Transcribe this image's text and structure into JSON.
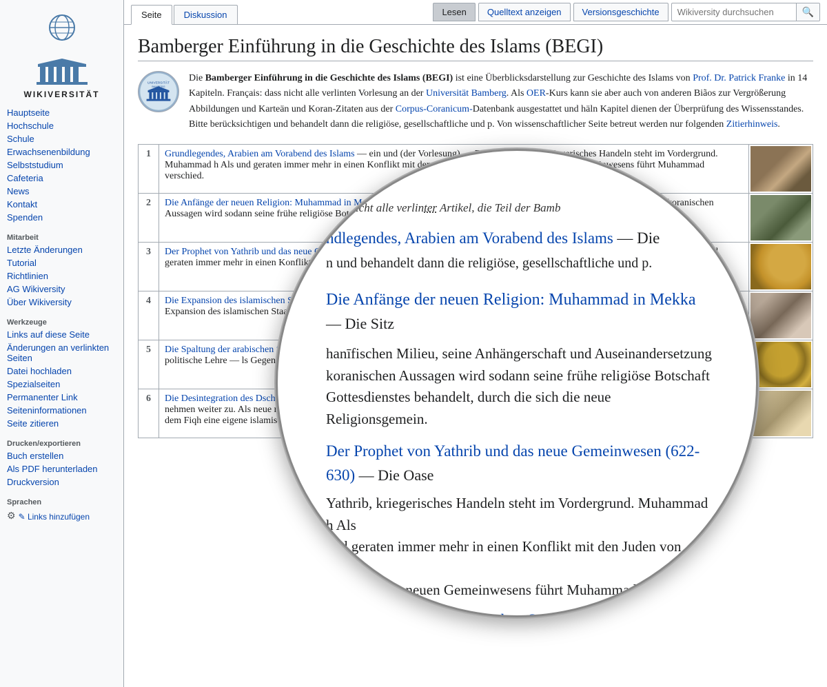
{
  "logo": {
    "text": "WIKIVERSITÄT"
  },
  "sidebar": {
    "nav_main": [
      {
        "label": "Hauptseite",
        "href": "#"
      },
      {
        "label": "Hochschule",
        "href": "#"
      },
      {
        "label": "Schule",
        "href": "#"
      },
      {
        "label": "Erwachsenenbildung",
        "href": "#"
      },
      {
        "label": "Selbststudium",
        "href": "#"
      },
      {
        "label": "Cafeteria",
        "href": "#"
      },
      {
        "label": "News",
        "href": "#"
      },
      {
        "label": "Kontakt",
        "href": "#"
      },
      {
        "label": "Spenden",
        "href": "#"
      }
    ],
    "section_mitarbeit": "Mitarbeit",
    "nav_mitarbeit": [
      {
        "label": "Letzte Änderungen",
        "href": "#"
      },
      {
        "label": "Tutorial",
        "href": "#"
      },
      {
        "label": "Richtlinien",
        "href": "#"
      },
      {
        "label": "AG Wikiversity",
        "href": "#"
      },
      {
        "label": "Über Wikiversity",
        "href": "#"
      }
    ],
    "section_werkzeuge": "Werkzeuge",
    "nav_werkzeuge": [
      {
        "label": "Links auf diese Seite",
        "href": "#"
      },
      {
        "label": "Änderungen an verlinkten Seiten",
        "href": "#"
      },
      {
        "label": "Datei hochladen",
        "href": "#"
      },
      {
        "label": "Spezialseiten",
        "href": "#"
      },
      {
        "label": "Permanenter Link",
        "href": "#"
      },
      {
        "label": "Seiteninformationen",
        "href": "#"
      },
      {
        "label": "Seite zitieren",
        "href": "#"
      }
    ],
    "section_drucken": "Drucken/exportieren",
    "nav_drucken": [
      {
        "label": "Buch erstellen",
        "href": "#"
      },
      {
        "label": "Als PDF herunterladen",
        "href": "#"
      },
      {
        "label": "Druckversion",
        "href": "#"
      }
    ],
    "section_sprachen": "Sprachen",
    "lang_add": "✎ Links hinzufügen"
  },
  "tabs": {
    "left": [
      {
        "label": "Seite",
        "active": true
      },
      {
        "label": "Diskussion",
        "active": false
      }
    ],
    "right": [
      {
        "label": "Lesen",
        "active": true
      },
      {
        "label": "Quelltext anzeigen",
        "active": false
      },
      {
        "label": "Versionsgeschichte",
        "active": false
      }
    ],
    "search_placeholder": "Wikiversity durchsuchen"
  },
  "page": {
    "title": "Bamberger Einführung in die Geschichte des Islams (BEGI)",
    "intro": "Die Bamberger Einführung in die Geschichte des Islams (BEGI) ist eine Überblicksdarstellung zur Geschichte des Islams von Prof. Dr. Patrick Franke in 14 Kapiteln. Français: dass nicht alle verlinten Vorlesung an der Universität Bamberg. Als OER-Kurs kann sie aber auch von anderen Biãos zur Vergrößerung Abbildungen und Karteän und Koran-Zitaten aus der Corpus-Coranicum-Datenbank ausgestattet und häln Kapitel dienen der Überprüfung des Wissensstandes.",
    "note": "Bitte berücksichtigen und behandelt dann die religiöse, gesellschaftliche und p. Von wissenschaftlicher Seite betreut werden nur folgenden Zitierhinweis.",
    "zitierhinweis_label": "Zitierhinweis",
    "table_rows": [
      {
        "num": "1",
        "title": "Grundlegendes, Arabien am Vorabend des Islams",
        "desc": "ein und (der Vorlesung) — Die Oase Yathrib, kriegerisches Handeln steht im Vordergrund. Muhammad h Als und geraten immer mehr in einen Konflikt mit den Juden von Yath. Anführer des neuen Gemeinwesens führt Muhammad verschied.",
        "img_class": "img-1"
      },
      {
        "num": "2",
        "title": "Die Anfänge der neuen Religion: Muhammad in Mekka",
        "desc": "hanīfischen Milieu, seine Anhängerschaft und Auseinandersetzung im koranischen Aussagen wird sodann seine frühe religiöse Botschaft von Gottesdienstes behandelt, durch die sich die neue Religionsgemein.",
        "img_class": "img-2"
      },
      {
        "num": "3",
        "title": "Der Prophet von Yathrib und das neue Gemeinwesen (622-630)",
        "desc": "Yathrib, kriegerisches Handeln steht im Vordergrund. Muhammad h Als und geraten immer mehr in einen Konflikt mit den Juden von Yath. Anführer des neuen Gemeinwesens führt Muhammad versch.",
        "img_class": "img-3"
      },
      {
        "num": "4",
        "title": "Die Expansion des islamischen Staates und das frühe Kalifat",
        "desc": "Macht in A — wichtigsten Hilfe der ara — mten Vorderen Orients führt. Die Expansion des islamischen Staates und das frühe Kalifa",
        "img_class": "img-4"
      },
      {
        "num": "5",
        "title": "Die Spaltung der arabischen Stämme eine Expansionsbewegu",
        "desc": "sichtbar wurden, bre — des Kalifats ʿUthmāns — gruppen, die eigene religiös-politische Lehre — ls Gegenheiligtum zur Kaaba den Felsendom. Als neue reli. Wichtige religiöse Neuerungen: die R.",
        "img_class": "img-5"
      },
      {
        "num": "6",
        "title": "Die Desintegration des Dschihad-Staa",
        "desc": "erlebt ihren Höhepunkt und Niedergang. Soziale Spannungen zwischen Arabern und Nicht-Arabern nehmen weiter zu. Als neue religiös-politische Parteien entstehen Murdschiʾa, Qadarīya, Dschahmīya und Ibādīya. Darüber hinaus bildet sich mit dem Fiqh eine eigene islamische Normenlehre heraus, die in verschiedenen lokalen Schulen gepflegt wird.",
        "img_class": "img-6"
      }
    ]
  },
  "magnifier": {
    "note": "dass nicht alle verlinten Artikel, die Teil der Bamb",
    "link1": "ndlegendes, Arabien am Vorabend des Islams — Die",
    "text1": "n und behandelt dann die religiöse, gesellschaftliche und p.",
    "link2": "Die Anfänge der neuen Religion: Muhammad in Mekka",
    "dash2": " — Die Sitz",
    "text2": "hanīfischen Milieu, seine Anhängerschaft und Auseinandersetzung\nkoranischen Aussagen wird sodann seine frühe religiöse Botschaft\nGottesdienstes behandelt, durch die sich die neue Religionsgemein.",
    "link3": "Der Prophet von Yathrib und das neue Gemeinwesen (622-630)",
    "dash3": " — Die Oase",
    "text3": "Yathrib, kriegerisches Handeln steht im Vordergrund. Muhammad h Als\nund geraten immer mehr in einen Konflikt mit den Juden von Yath.\nAnführer des neuen Gemeinwesens führt Muhammad versch.",
    "link4": "Die Expansion des islamischen Staates und das frühe Kalifa"
  }
}
